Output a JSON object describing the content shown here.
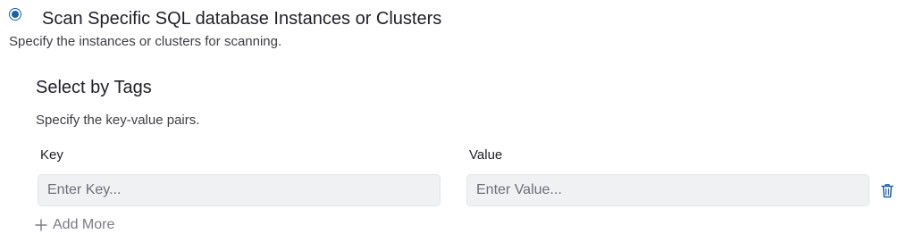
{
  "scan_option": {
    "selected": true,
    "title": "Scan Specific SQL database Instances or Clusters",
    "description": "Specify the instances or clusters for scanning."
  },
  "tags_section": {
    "title": "Select by Tags",
    "description": "Specify the key-value pairs.",
    "key_label": "Key",
    "value_label": "Value",
    "key_placeholder": "Enter Key...",
    "value_placeholder": "Enter Value...",
    "key_value": "",
    "value_value": "",
    "add_more_label": "Add More"
  },
  "icons": {
    "radio": "radio-selected-icon",
    "delete": "trash-icon",
    "add": "plus-icon"
  },
  "colors": {
    "accent": "#1b5fa8",
    "input_bg": "#f0f1f3",
    "muted_text": "#7a7b83"
  }
}
